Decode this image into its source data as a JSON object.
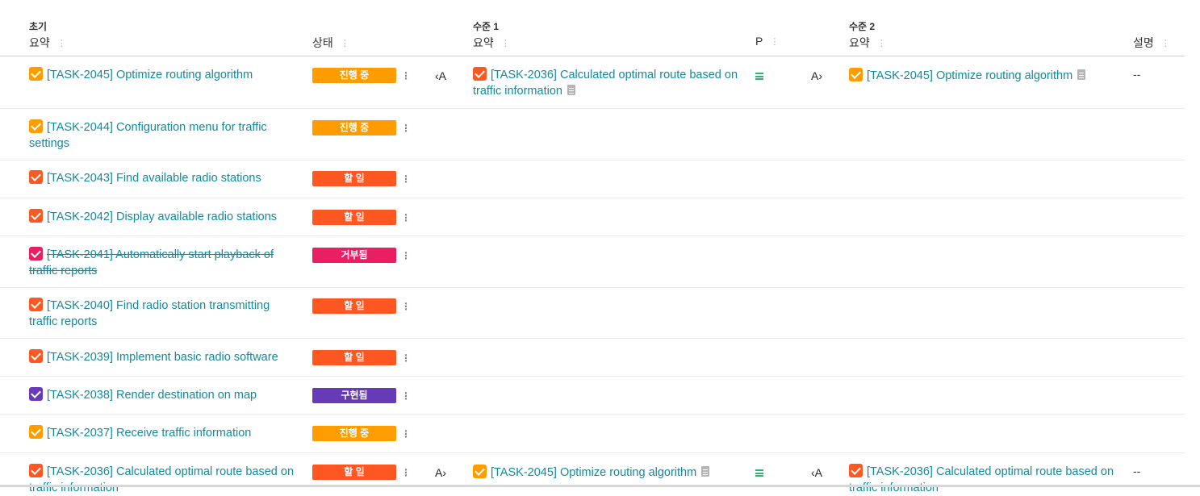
{
  "colors": {
    "link": "#138a9e",
    "status_in_progress": "#ff9d00",
    "status_todo": "#ff5722",
    "status_rejected": "#e91e63",
    "status_implemented": "#673ab7",
    "priority": "#2bb673",
    "cb_orange": "#ff9d00",
    "cb_red": "#ff5722",
    "cb_pink": "#e91e63",
    "cb_purple": "#673ab7"
  },
  "groups": {
    "initial": "초기",
    "level1": "수준 1",
    "level2": "수준 2"
  },
  "columns": {
    "summary": "요약",
    "status": "상태",
    "summary_l1": "요약",
    "priority": "P",
    "summary_l2": "요약",
    "description": "설명"
  },
  "rows": [
    {
      "task": "[TASK-2045] Optimize routing algorithm",
      "task_line2": "",
      "status": "진행 중",
      "link_l1": "‹A",
      "l1_task": "[TASK-2036] Calculated optimal route based on",
      "l1_task_line2": "traffic information",
      "link_l2": "A›",
      "l2_task": "[TASK-2045] Optimize routing algorithm",
      "l2_task_line2": "",
      "description": "--"
    },
    {
      "task": "[TASK-2044] Configuration menu for traffic",
      "task_line2": "settings",
      "status": "진행 중"
    },
    {
      "task": "[TASK-2043] Find available radio stations",
      "task_line2": "",
      "status": "할 일"
    },
    {
      "task": "[TASK-2042] Display available radio stations",
      "task_line2": "",
      "status": "할 일"
    },
    {
      "task": "[TASK-2041] Automatically start playback of",
      "task_line2": "traffic reports",
      "status": "거부됨"
    },
    {
      "task": "[TASK-2040] Find radio station transmitting",
      "task_line2": "traffic reports",
      "status": "할 일"
    },
    {
      "task": "[TASK-2039] Implement basic radio software",
      "task_line2": "",
      "status": "할 일"
    },
    {
      "task": "[TASK-2038] Render destination on map",
      "task_line2": "",
      "status": "구현됨"
    },
    {
      "task": "[TASK-2037] Receive traffic information",
      "task_line2": "",
      "status": "진행 중"
    },
    {
      "task": "[TASK-2036] Calculated optimal route based on",
      "task_line2": "traffic information",
      "status": "할 일",
      "link_l1": "A›",
      "l1_task": "[TASK-2045] Optimize routing algorithm",
      "l1_task_line2": "",
      "link_l2": "‹A",
      "l2_task": "[TASK-2036] Calculated optimal route based on",
      "l2_task_line2": "traffic information",
      "description": "--"
    }
  ]
}
